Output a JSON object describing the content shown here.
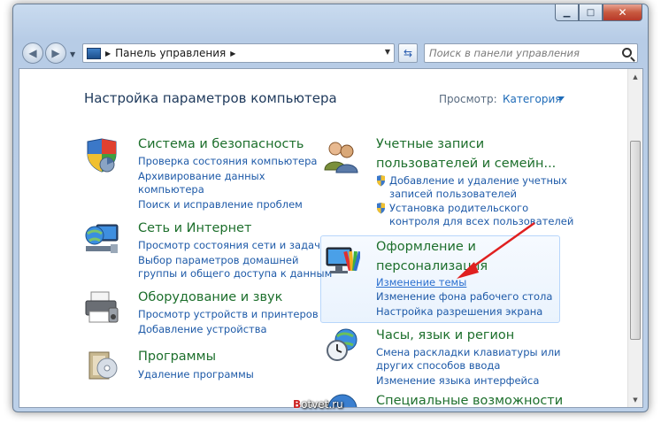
{
  "window": {
    "minimize_icon": "minimize-icon",
    "maximize_icon": "maximize-icon",
    "close_icon": "close-icon"
  },
  "nav": {
    "address_segments": [
      "Панель управления"
    ],
    "search_placeholder": "Поиск в панели управления"
  },
  "header": {
    "title": "Настройка параметров компьютера",
    "view_label": "Просмотр:",
    "view_value": "Категория"
  },
  "categories": {
    "system": {
      "title": "Система и безопасность",
      "links": [
        "Проверка состояния компьютера",
        "Архивирование данных",
        "компьютера",
        "Поиск и исправление проблем"
      ]
    },
    "network": {
      "title": "Сеть и Интернет",
      "links": [
        "Просмотр состояния сети и задач",
        "Выбор параметров домашней",
        "группы и общего доступа к данным"
      ]
    },
    "hardware": {
      "title": "Оборудование и звук",
      "links": [
        "Просмотр устройств и принтеров",
        "Добавление устройства"
      ]
    },
    "programs": {
      "title": "Программы",
      "links": [
        "Удаление программы"
      ]
    },
    "accounts": {
      "title_line1": "Учетные записи",
      "title_line2": "пользователей и семейн...",
      "links": [
        "Добавление и удаление учетных",
        "записей пользователей",
        "Установка родительского",
        "контроля для всех пользователей"
      ]
    },
    "appearance": {
      "title_line1": "Оформление и",
      "title_line2": "персонализация",
      "links": [
        "Изменение темы",
        "Изменение фона рабочего стола",
        "Настройка разрешения экрана"
      ]
    },
    "clock": {
      "title": "Часы, язык и регион",
      "links": [
        "Смена раскладки клавиатуры или",
        "других способов ввода",
        "Изменение языка интерфейса"
      ]
    },
    "access": {
      "title": "Специальные возможности"
    }
  },
  "annotation": {
    "arrow_color": "#e02020"
  },
  "watermark": {
    "letter": "B",
    "text": "otvet.ru"
  }
}
